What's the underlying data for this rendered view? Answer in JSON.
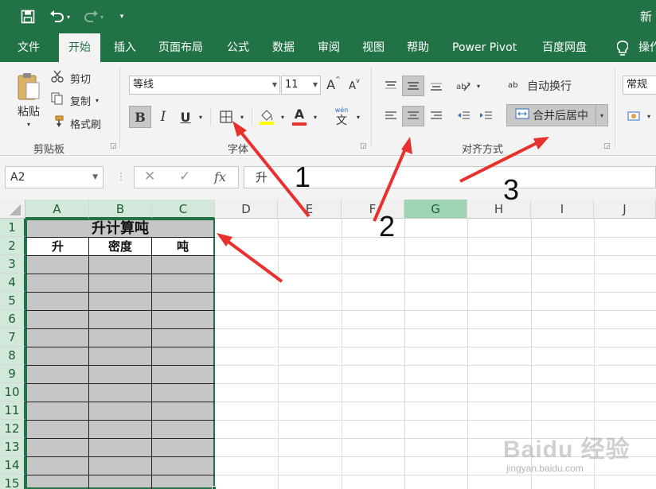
{
  "titlebar": {
    "title": "新",
    "save_icon": "save-icon",
    "undo_icon": "undo-icon",
    "redo_icon": "redo-icon"
  },
  "menu": {
    "tabs": [
      "文件",
      "开始",
      "插入",
      "页面布局",
      "公式",
      "数据",
      "审阅",
      "视图",
      "帮助",
      "Power Pivot",
      "百度网盘",
      "操作"
    ],
    "active": "开始",
    "lightbulb_icon": "lightbulb-icon"
  },
  "ribbon": {
    "clipboard": {
      "paste": "粘贴",
      "cut": "剪切",
      "copy": "复制",
      "format_painter": "格式刷",
      "group_label": "剪贴板"
    },
    "font": {
      "font_name": "等线",
      "font_size": "11",
      "grow": "A",
      "shrink": "A",
      "bold": "B",
      "italic": "I",
      "underline": "U",
      "font_color": "A",
      "wen": "wén",
      "wen_char": "文",
      "group_label": "字体"
    },
    "alignment": {
      "wrap_text": "自动换行",
      "merge_center": "合并后居中",
      "group_label": "对齐方式",
      "wrap_ab": "ab"
    },
    "number": {
      "format": "常规"
    }
  },
  "formula_bar": {
    "name_box": "A2",
    "formula": "升",
    "fx": "fx"
  },
  "sheet": {
    "columns": [
      "A",
      "B",
      "C",
      "D",
      "E",
      "F",
      "G",
      "H",
      "I",
      "J"
    ],
    "rows": [
      "1",
      "2",
      "3",
      "4",
      "5",
      "6",
      "7",
      "8",
      "9",
      "10",
      "11",
      "12",
      "13",
      "14",
      "15"
    ],
    "title_cell": "升计算吨",
    "headers": [
      "升",
      "密度",
      "吨"
    ]
  },
  "annotations": {
    "one": "1",
    "two": "2",
    "three": "3"
  },
  "watermark": {
    "brand": "Baidu 经验",
    "url": "jingyan.baidu.com"
  },
  "colors": {
    "excel_green": "#217346",
    "arrow_red": "#e8312f",
    "selection_gray": "#c6c6c6"
  }
}
